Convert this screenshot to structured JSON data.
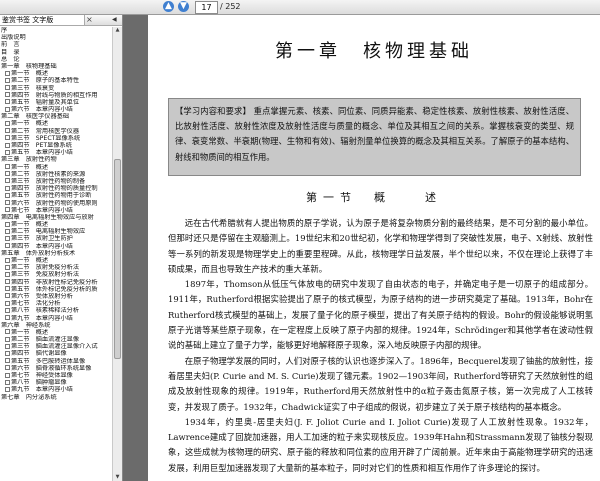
{
  "toolbar": {
    "prev": "▲",
    "next": "▼",
    "page_current": "17",
    "page_total": "/ 252"
  },
  "sidebar": {
    "tab_label": "鉴赏书签 文字版",
    "tab_close": "×",
    "tab_arrow": "◀",
    "outline": [
      {
        "label": "序",
        "lvl": 0,
        "box": false
      },
      {
        "label": "出版说明",
        "lvl": 0,
        "box": false
      },
      {
        "label": "前　言",
        "lvl": 0,
        "box": false
      },
      {
        "label": "目　录",
        "lvl": 0,
        "box": false
      },
      {
        "label": "总　论",
        "lvl": 0,
        "box": false
      },
      {
        "label": "第一章　核物理基础",
        "lvl": 0,
        "box": false
      },
      {
        "label": "第一节　概述",
        "lvl": 1,
        "box": true
      },
      {
        "label": "第二节　原子的基本特性",
        "lvl": 1,
        "box": true
      },
      {
        "label": "第三节　核衰变",
        "lvl": 1,
        "box": true
      },
      {
        "label": "第四节　射线与物质的相互作用",
        "lvl": 1,
        "box": true
      },
      {
        "label": "第五节　辐射量及其单位",
        "lvl": 1,
        "box": true
      },
      {
        "label": "第六节　本章内容小结",
        "lvl": 1,
        "box": true
      },
      {
        "label": "第二章　核医学仪器基础",
        "lvl": 0,
        "box": false
      },
      {
        "label": "第一节　概述",
        "lvl": 1,
        "box": true
      },
      {
        "label": "第二节　常用核医学仪器",
        "lvl": 1,
        "box": true
      },
      {
        "label": "第三节　SPECT显像系统",
        "lvl": 1,
        "box": true
      },
      {
        "label": "第四节　PET显像系统",
        "lvl": 1,
        "box": true
      },
      {
        "label": "第五节　本章内容小结",
        "lvl": 1,
        "box": true
      },
      {
        "label": "第三章　放射性药物",
        "lvl": 0,
        "box": false
      },
      {
        "label": "第一节　概述",
        "lvl": 1,
        "box": true
      },
      {
        "label": "第二节　放射性核素的来源",
        "lvl": 1,
        "box": true
      },
      {
        "label": "第三节　放射性药物的制备",
        "lvl": 1,
        "box": true
      },
      {
        "label": "第四节　放射性药物的质量控制",
        "lvl": 1,
        "box": true
      },
      {
        "label": "第五节　放射性药物用于诊断",
        "lvl": 1,
        "box": true
      },
      {
        "label": "第六节　放射性药物的使用原则",
        "lvl": 1,
        "box": true
      },
      {
        "label": "第七节　本章内容小结",
        "lvl": 1,
        "box": true
      },
      {
        "label": "第四章　电离辐射生物效应与放射",
        "lvl": 0,
        "box": false
      },
      {
        "label": "第一节　概述",
        "lvl": 1,
        "box": true
      },
      {
        "label": "第二节　电离辐射生物效应",
        "lvl": 1,
        "box": true
      },
      {
        "label": "第三节　放射卫生防护",
        "lvl": 1,
        "box": true
      },
      {
        "label": "第四节　本章内容小结",
        "lvl": 1,
        "box": true
      },
      {
        "label": "第五章　体外放射分析技术",
        "lvl": 0,
        "box": false
      },
      {
        "label": "第一节　概述",
        "lvl": 1,
        "box": true
      },
      {
        "label": "第二节　放射免疫分析法",
        "lvl": 1,
        "box": true
      },
      {
        "label": "第三节　免疫放射分析法",
        "lvl": 1,
        "box": true
      },
      {
        "label": "第四节　非放射性标记免疫分析",
        "lvl": 1,
        "box": true
      },
      {
        "label": "第五节　体外标记免疫分析的质",
        "lvl": 1,
        "box": true
      },
      {
        "label": "第六节　受体放射分析",
        "lvl": 1,
        "box": true
      },
      {
        "label": "第七节　活化分析",
        "lvl": 1,
        "box": true
      },
      {
        "label": "第八节　核素稀释法分析",
        "lvl": 1,
        "box": true
      },
      {
        "label": "第九节　本章内容小结",
        "lvl": 1,
        "box": true
      },
      {
        "label": "第六章　神经系统",
        "lvl": 0,
        "box": false
      },
      {
        "label": "第一节　概述",
        "lvl": 1,
        "box": true
      },
      {
        "label": "第二节　脑血流灌注显像",
        "lvl": 1,
        "box": true
      },
      {
        "label": "第三节　脑血流灌注显像介入试",
        "lvl": 1,
        "box": true
      },
      {
        "label": "第四节　脑代谢显像",
        "lvl": 1,
        "box": true
      },
      {
        "label": "第五节　多巴胺转运体显像",
        "lvl": 1,
        "box": true
      },
      {
        "label": "第六节　脑脊液循环系统显像",
        "lvl": 1,
        "box": true
      },
      {
        "label": "第七节　神经受体显像",
        "lvl": 1,
        "box": true
      },
      {
        "label": "第八节　脑肿瘤显像",
        "lvl": 1,
        "box": true
      },
      {
        "label": "第九节　本章内容小结",
        "lvl": 1,
        "box": true
      },
      {
        "label": "第七章　内分泌系统",
        "lvl": 0,
        "box": false
      }
    ]
  },
  "document": {
    "chapter_title": "第一章　核物理基础",
    "intro": "【学习内容和要求】 重点掌握元素、核素、同位素、同质异能素、稳定性核素、放射性核素、放射性活度、比放射性活度、放射性浓度及放射性活度与质量的概念、单位及其相互之间的关系。掌握核衰变的类型、规律、衰变常数、半衰期(物理、生物和有效)、辐射剂量单位换算的概念及其相互关系。了解原子的基本结构、射线和物质间的相互作用。",
    "section_title": "第一节　概　　述",
    "paragraphs": [
      "远在古代希腊就有人提出物质的原子学说，认为原子是将复杂物质分割的最终结果，是不可分割的最小单位。但那时还只是停留在主观臆测上。19世纪末和20世纪初，化学和物理学得到了突破性发展，电子、X射线、放射性等一系列的新发现是物理学史上的重要里程碑。从此，核物理学日益发展，半个世纪以来，不仅在理论上获得了丰硕成果，而且也导致生产技术的重大革新。",
      "1897年，Thomson从低压气体放电的研究中发现了自由状态的电子，并确定电子是一切原子的组成部分。1911年，Rutherford根据实验提出了原子的核式模型，为原子结构的进一步研究奠定了基础。1913年，Bohr在Rutherford核式模型的基础上，发展了量子化的原子模型，提出了有关原子结构的假设。Bohr的假设能够说明氢原子光谱等某些原子现象，在一定程度上反映了原子内部的规律。1924年，Schrödinger和其他学者在波动性假说的基础上建立了量子力学，能够更好地解释原子现象，深入地反映原子内部的规律。",
      "在原子物理学发展的同时，人们对原子核的认识也逐步深入了。1896年，Becquerel发现了铀盐的放射性，接着居里夫妇(P. Curie and M. S. Curie)发现了镭元素。1902—1903年间，Rutherford等研究了天然放射性的组成及放射性现象的规律。1919年，Rutherford用天然放射性中的α粒子轰击氮原子核，第一次完成了人工核转变，并发现了质子。1932年，Chadwick证实了中子组成的假说，初步建立了关于原子核结构的基本概念。",
      "1934年，约里奥-居里夫妇(J. F. Joliot Curie and I. Joliot Curie)发现了人工放射性现象。1932年，Lawrence建成了回旋加速器，用人工加速的粒子来实现核反应。1939年Hahn和Strassmann发现了铀核分裂现象，这些成就为核物理的研究、原子能的释放和同位素的应用开辟了广阔前景。近年来由于高能物理学研究的迅速发展，利用巨型加速器发现了大量新的基本粒子，同时对它们的性质和相互作用作了许多理论的探讨。"
    ]
  }
}
